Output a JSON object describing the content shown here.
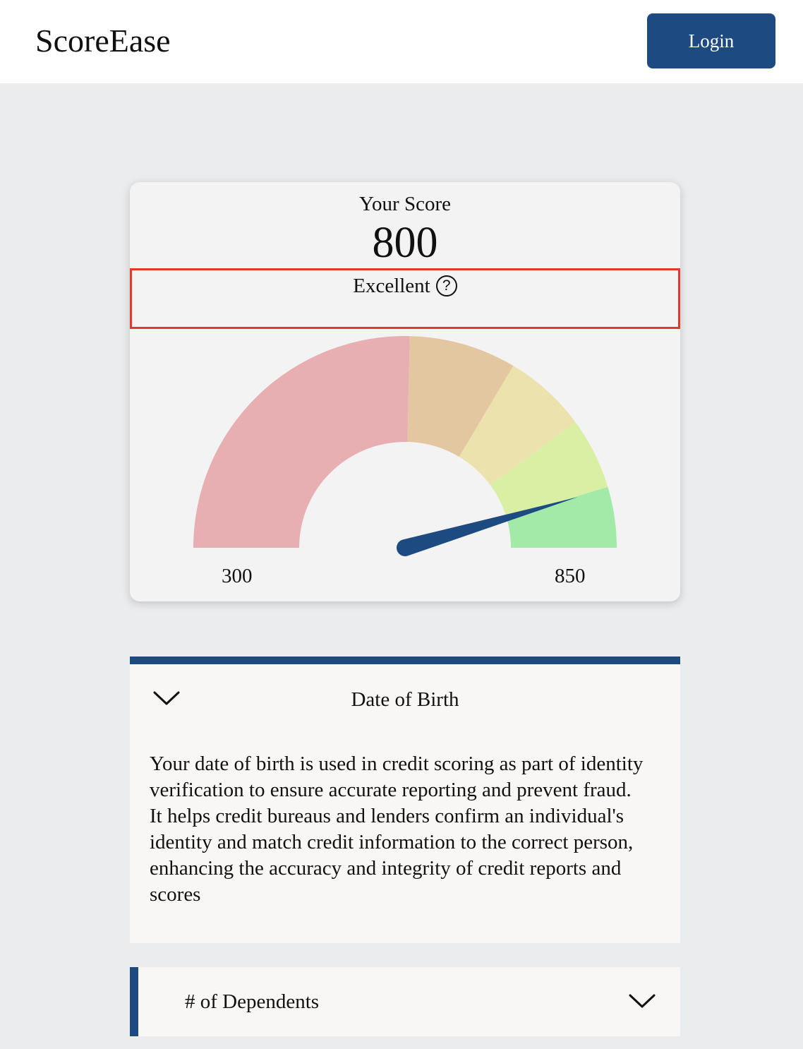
{
  "header": {
    "brand": "ScoreEase",
    "login_label": "Login"
  },
  "score_card": {
    "label": "Your Score",
    "score": 800,
    "score_text": "800",
    "rating": "Excellent",
    "help_icon": "question-circle-icon",
    "help_glyph": "?",
    "min_label": "300",
    "max_label": "850",
    "gauge": {
      "min": 300,
      "max": 850,
      "needle_color": "#1d4a80",
      "bands": [
        {
          "from": 300,
          "to": 579,
          "color": "#e8afb2"
        },
        {
          "from": 579,
          "to": 669,
          "color": "#e3c7a0"
        },
        {
          "from": 669,
          "to": 739,
          "color": "#ebe2ad"
        },
        {
          "from": 739,
          "to": 799,
          "color": "#d9f0a4"
        },
        {
          "from": 799,
          "to": 850,
          "color": "#a3eaa8"
        }
      ]
    }
  },
  "accordion": [
    {
      "title": "Date of Birth",
      "expanded": true,
      "icon": "chevron-down-icon",
      "body": "Your date of birth is used in credit scoring as part of identity verification to ensure accurate reporting and prevent fraud. It helps credit bureaus and lenders confirm an individual's identity and match credit information to the correct person, enhancing the accuracy and integrity of credit reports and scores"
    },
    {
      "title": "# of Dependents",
      "expanded": false,
      "icon": "chevron-down-icon"
    }
  ],
  "colors": {
    "accent": "#1d4a80",
    "highlight_border": "#e0392d",
    "page_background": "#ebecee",
    "card_background": "#f3f3f4"
  }
}
